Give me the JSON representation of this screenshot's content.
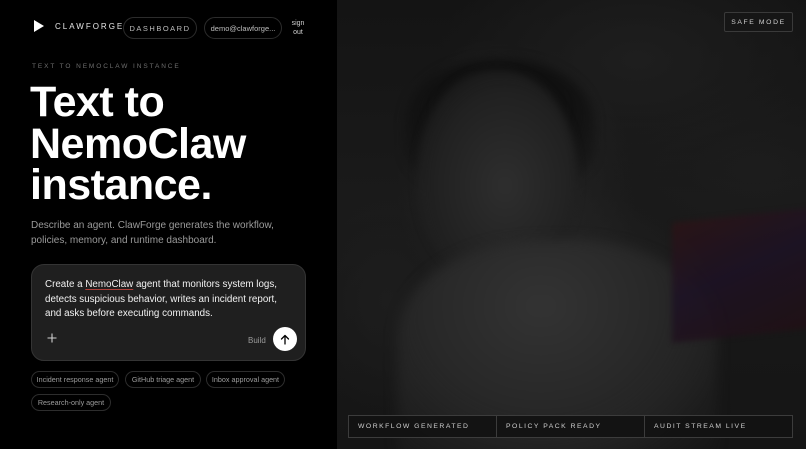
{
  "nav": {
    "brand": "CLAWFORGE",
    "dashboard_label": "DASHBOARD",
    "email_label": "demo@clawforge...",
    "signout_label": "sign out"
  },
  "hero": {
    "eyebrow": "TEXT TO NEMOCLAW INSTANCE",
    "title_line1": "Text to",
    "title_line2": "NemoClaw",
    "title_line3": "instance.",
    "subtitle": "Describe an agent. ClawForge generates the workflow, policies, memory, and runtime dashboard."
  },
  "prompt": {
    "text_before": "Create a ",
    "text_underlined": "NemoClaw",
    "text_after": " agent that monitors system logs, detects suspicious behavior, writes an incident report, and asks before executing commands.",
    "add_icon": "plus-icon",
    "build_label": "Build",
    "send_icon": "arrow-up-icon"
  },
  "suggestions": [
    "Incident response agent",
    "GitHub triage agent",
    "Inbox approval agent",
    "Research-only agent"
  ],
  "badge": {
    "safe_mode": "SAFE MODE"
  },
  "status": [
    "WORKFLOW GENERATED",
    "POLICY PACK READY",
    "AUDIT STREAM LIVE"
  ],
  "colors": {
    "background": "#000000",
    "accent": "#ffffff",
    "muted_text": "#9a9a9a",
    "card": "#1f1f1f"
  }
}
